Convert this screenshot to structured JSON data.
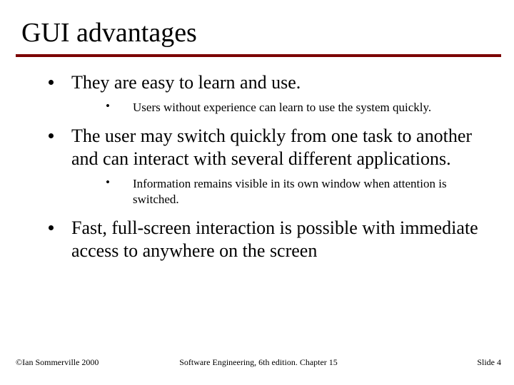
{
  "title": "GUI advantages",
  "bullets": [
    {
      "text": "They are easy to learn and use.",
      "sub": [
        "Users without experience can learn to use the system quickly."
      ]
    },
    {
      "text": "The user may switch quickly from one task to another and can interact with several different applications.",
      "sub": [
        "Information remains visible in its own window when attention is switched."
      ]
    },
    {
      "text": "Fast, full-screen interaction is possible with immediate access to anywhere on the screen",
      "sub": []
    }
  ],
  "footer": {
    "left": "©Ian Sommerville 2000",
    "center": "Software Engineering, 6th edition. Chapter 15",
    "right": "Slide 4"
  }
}
